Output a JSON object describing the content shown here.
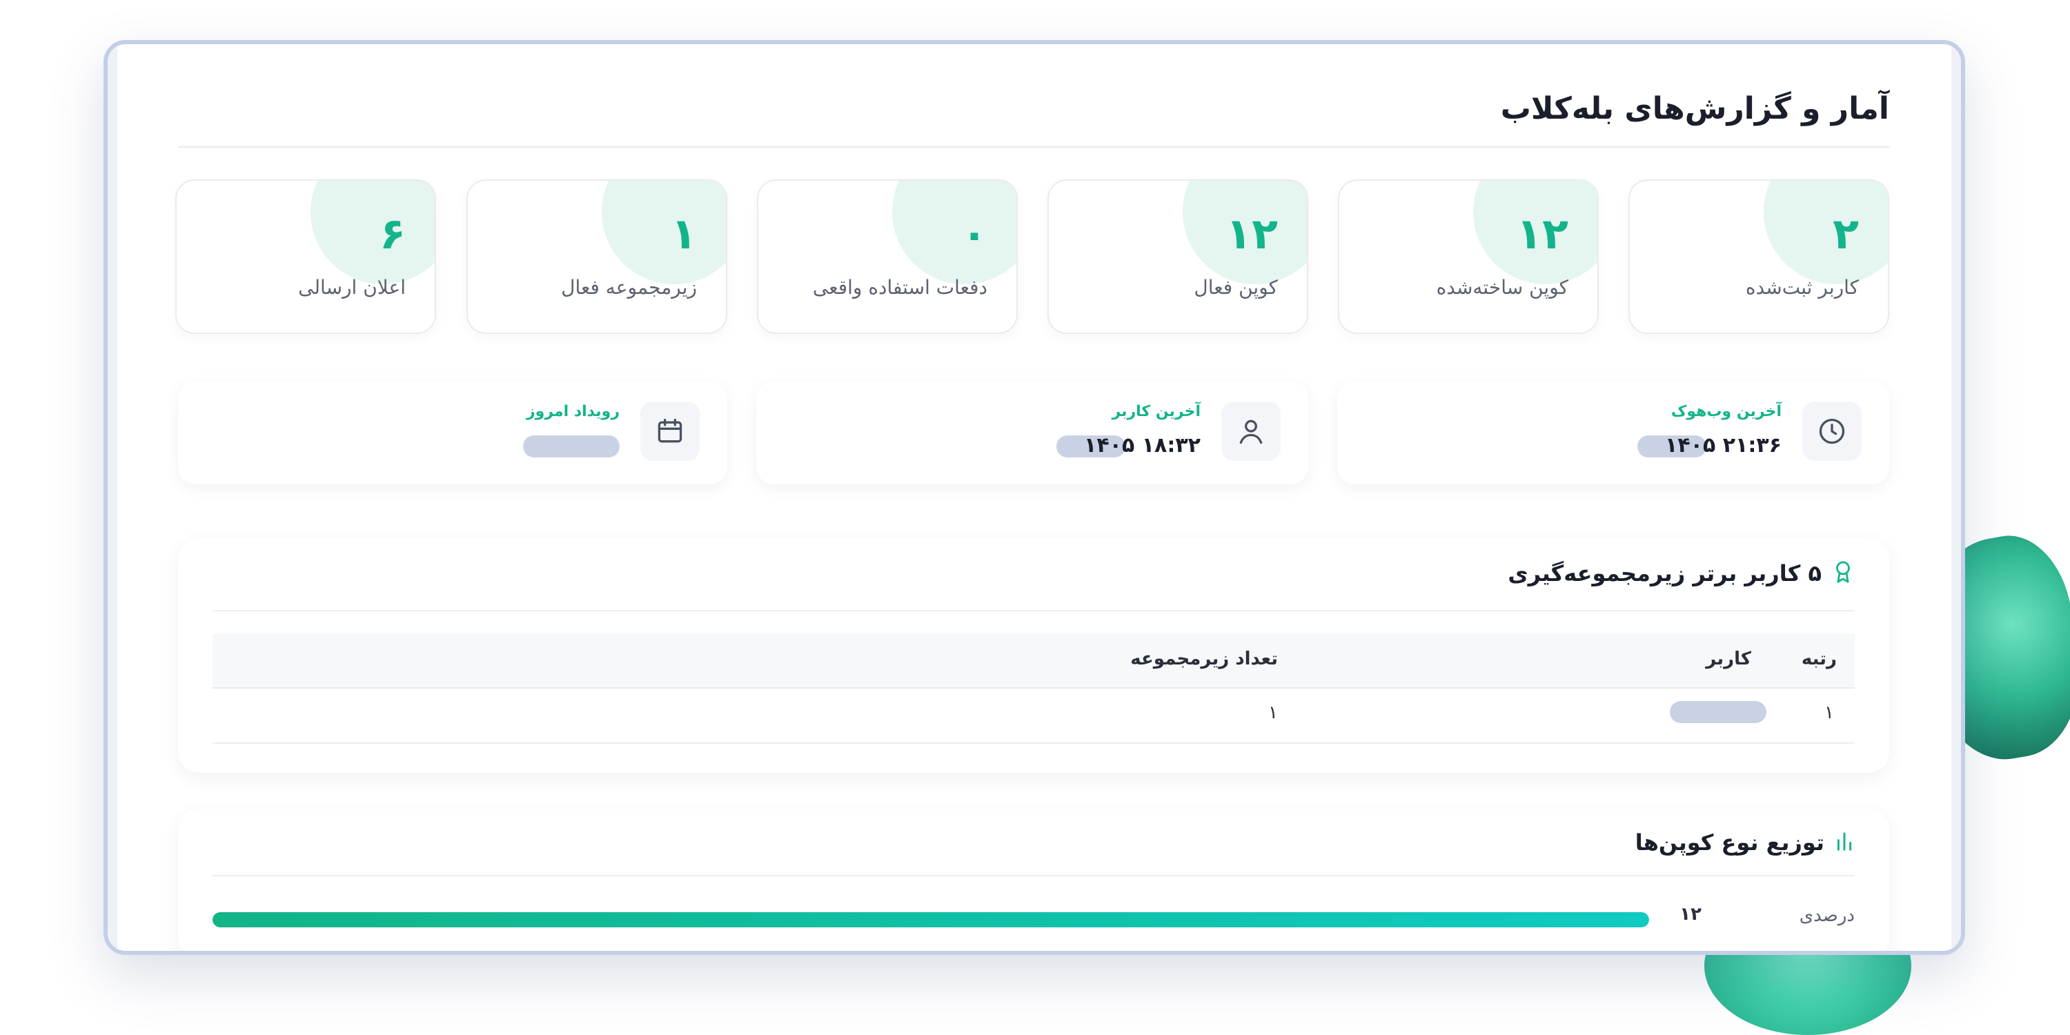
{
  "page": {
    "title": "آمار و گزارش‌های بله‌کلاب"
  },
  "stats": [
    {
      "value": "۲",
      "label": "کاربر ثبت‌شده"
    },
    {
      "value": "۱۲",
      "label": "کوپن ساخته‌شده"
    },
    {
      "value": "۱۲",
      "label": "کوپن فعال"
    },
    {
      "value": "۰",
      "label": "دفعات استفاده واقعی"
    },
    {
      "value": "۱",
      "label": "زیرمجموعه فعال"
    },
    {
      "value": "۶",
      "label": "اعلان ارسالی"
    }
  ],
  "info": {
    "webhook": {
      "title": "آخرین وب‌هوک",
      "value": "۲۱:۳۶ ۱۴۰۵",
      "icon": "clock-icon"
    },
    "user": {
      "title": "آخرین کاربر",
      "value": "۱۸:۳۲ ۱۴۰۵",
      "icon": "user-icon"
    },
    "event": {
      "title": "رویداد امروز",
      "value": "",
      "icon": "calendar-icon"
    }
  },
  "top_users": {
    "title": "۵ کاربر برتر زیرمجموعه‌گیری",
    "icon": "award-ribbon-icon",
    "columns": {
      "rank": "رتبه",
      "user": "کاربر",
      "count": "تعداد زیرمجموعه"
    },
    "rows": [
      {
        "rank": "۱",
        "user": "",
        "count": "۱"
      }
    ]
  },
  "coupon_dist": {
    "title": "توزیع نوع کوپن‌ها",
    "icon": "bar-chart-icon",
    "items": [
      {
        "label": "درصدی",
        "count": "۱۲",
        "fraction": 1.0
      }
    ]
  },
  "colors": {
    "accent": "#14b48b",
    "accent_light": "#e4f6ef",
    "frame_border": "#c3cfe6",
    "redaction": "#c9d2e4"
  }
}
